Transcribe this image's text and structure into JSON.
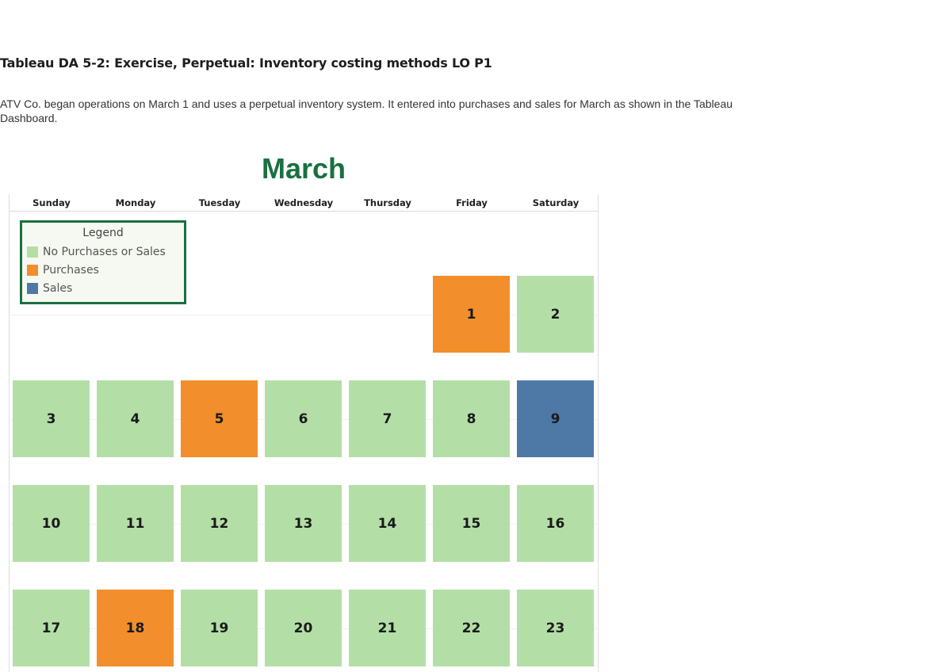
{
  "page": {
    "title": "Tableau DA 5-2: Exercise, Perpetual: Inventory costing methods LO P1",
    "intro": "ATV Co. began operations on March 1 and uses a perpetual inventory system. It entered into purchases and sales for March as shown in the Tableau Dashboard."
  },
  "calendar": {
    "month": "March",
    "weekdays": [
      "Sunday",
      "Monday",
      "Tuesday",
      "Wednesday",
      "Thursday",
      "Friday",
      "Saturday"
    ],
    "colors": {
      "none": "#b3dfa7",
      "purchases": "#f28e2b",
      "sales": "#4e79a7",
      "title": "#1a7040"
    },
    "legend": {
      "title": "Legend",
      "items": [
        {
          "label": "No Purchases or Sales",
          "key": "none"
        },
        {
          "label": "Purchases",
          "key": "purchases"
        },
        {
          "label": "Sales",
          "key": "sales"
        }
      ]
    },
    "days": [
      {
        "day": "1",
        "weekday": 5,
        "week": 0,
        "type": "purchases"
      },
      {
        "day": "2",
        "weekday": 6,
        "week": 0,
        "type": "none"
      },
      {
        "day": "3",
        "weekday": 0,
        "week": 1,
        "type": "none"
      },
      {
        "day": "4",
        "weekday": 1,
        "week": 1,
        "type": "none"
      },
      {
        "day": "5",
        "weekday": 2,
        "week": 1,
        "type": "purchases"
      },
      {
        "day": "6",
        "weekday": 3,
        "week": 1,
        "type": "none"
      },
      {
        "day": "7",
        "weekday": 4,
        "week": 1,
        "type": "none"
      },
      {
        "day": "8",
        "weekday": 5,
        "week": 1,
        "type": "none"
      },
      {
        "day": "9",
        "weekday": 6,
        "week": 1,
        "type": "sales"
      },
      {
        "day": "10",
        "weekday": 0,
        "week": 2,
        "type": "none"
      },
      {
        "day": "11",
        "weekday": 1,
        "week": 2,
        "type": "none"
      },
      {
        "day": "12",
        "weekday": 2,
        "week": 2,
        "type": "none"
      },
      {
        "day": "13",
        "weekday": 3,
        "week": 2,
        "type": "none"
      },
      {
        "day": "14",
        "weekday": 4,
        "week": 2,
        "type": "none"
      },
      {
        "day": "15",
        "weekday": 5,
        "week": 2,
        "type": "none"
      },
      {
        "day": "16",
        "weekday": 6,
        "week": 2,
        "type": "none"
      },
      {
        "day": "17",
        "weekday": 0,
        "week": 3,
        "type": "none"
      },
      {
        "day": "18",
        "weekday": 1,
        "week": 3,
        "type": "purchases"
      },
      {
        "day": "19",
        "weekday": 2,
        "week": 3,
        "type": "none"
      },
      {
        "day": "20",
        "weekday": 3,
        "week": 3,
        "type": "none"
      },
      {
        "day": "21",
        "weekday": 4,
        "week": 3,
        "type": "none"
      },
      {
        "day": "22",
        "weekday": 5,
        "week": 3,
        "type": "none"
      },
      {
        "day": "23",
        "weekday": 6,
        "week": 3,
        "type": "none"
      }
    ]
  }
}
